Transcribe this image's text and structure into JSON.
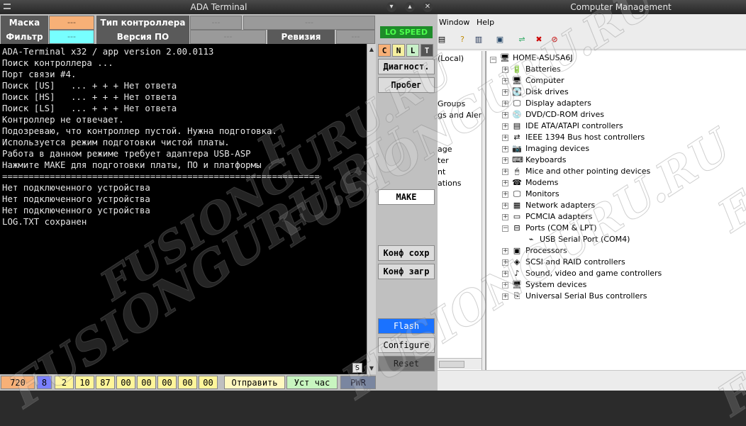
{
  "ada": {
    "title": "ADA Terminal",
    "labels": {
      "mask": "Маска",
      "filter": "Фильтр",
      "controller_type": "Тип контроллера",
      "version": "Версия ПО",
      "revision": "Ревизия"
    },
    "values": {
      "mask": "---",
      "filter": "---",
      "controller_type_1": "---",
      "controller_type_2": "---",
      "version": "---",
      "revision": "---"
    },
    "speed_badge": "LO SPEED",
    "cnlt": [
      "C",
      "N",
      "L",
      "T"
    ],
    "buttons": {
      "diag": "Диагност.",
      "probeg": "Пробег",
      "make": "MAKE",
      "conf_save": "Конф сохр",
      "conf_load": "Конф загр",
      "flash": "Flash",
      "configure": "Configure",
      "reset": "Reset"
    },
    "terminal_lines": [
      "ADA-Terminal x32 / app version 2.00.0113",
      "Поиск контроллера ...",
      "Порт связи #4.",
      "Поиск [US]   ... + + + Нет ответа",
      "Поиск [HS]   ... + + + Нет ответа",
      "Поиск [LS]   ... + + + Нет ответа",
      "Контроллер не отвечает.",
      "Подозреваю, что контроллер пустой. Нужна подготовка.",
      "Используется режим подготовки чистой платы.",
      "Работа в данном режиме требует адаптера USB-ASP",
      "Нажмите MAKE для подготовки платы, ПО и платформы",
      "============================================================",
      "Нет подключенного устройства",
      "Нет подключенного устройства",
      "Нет подключенного устройства",
      "LOG.TXT сохранен"
    ],
    "scroll_badge": "S",
    "status": {
      "num1": "720",
      "num2": "8",
      "bytes": [
        "2",
        "10",
        "87",
        "00",
        "00",
        "00",
        "00",
        "00"
      ],
      "send": "Отправить",
      "set_clock": "Уст час",
      "pwr": "PWR"
    }
  },
  "cm": {
    "title": "Computer Management",
    "menu": [
      "Window",
      "Help"
    ],
    "left_items": [
      "(Local)",
      "Groups",
      "gs and Alerts",
      "age",
      "ter",
      "nt",
      "ations"
    ],
    "root": "HOME-ASUSA6J",
    "devices": [
      {
        "label": "Batteries",
        "icon": "battery-icon",
        "glyph": "🔋"
      },
      {
        "label": "Computer",
        "icon": "computer-icon",
        "glyph": "🖥"
      },
      {
        "label": "Disk drives",
        "icon": "disk-drive-icon",
        "glyph": "💽"
      },
      {
        "label": "Display adapters",
        "icon": "display-adapter-icon",
        "glyph": "🖵"
      },
      {
        "label": "DVD/CD-ROM drives",
        "icon": "dvd-drive-icon",
        "glyph": "💿"
      },
      {
        "label": "IDE ATA/ATAPI controllers",
        "icon": "ide-controller-icon",
        "glyph": "▤"
      },
      {
        "label": "IEEE 1394 Bus host controllers",
        "icon": "ieee1394-icon",
        "glyph": "⇄"
      },
      {
        "label": "Imaging devices",
        "icon": "imaging-device-icon",
        "glyph": "📷"
      },
      {
        "label": "Keyboards",
        "icon": "keyboard-icon",
        "glyph": "⌨"
      },
      {
        "label": "Mice and other pointing devices",
        "icon": "mouse-icon",
        "glyph": "🖱"
      },
      {
        "label": "Modems",
        "icon": "modem-icon",
        "glyph": "☎"
      },
      {
        "label": "Monitors",
        "icon": "monitor-icon",
        "glyph": "🖵"
      },
      {
        "label": "Network adapters",
        "icon": "network-adapter-icon",
        "glyph": "▦"
      },
      {
        "label": "PCMCIA adapters",
        "icon": "pcmcia-icon",
        "glyph": "▭"
      },
      {
        "label": "Ports (COM & LPT)",
        "icon": "port-icon",
        "glyph": "⊟"
      },
      {
        "label": "USB Serial Port (COM4)",
        "icon": "serial-port-icon",
        "glyph": "⌁",
        "child": true
      },
      {
        "label": "Processors",
        "icon": "processor-icon",
        "glyph": "▣"
      },
      {
        "label": "SCSI and RAID controllers",
        "icon": "scsi-controller-icon",
        "glyph": "◈"
      },
      {
        "label": "Sound, video and game controllers",
        "icon": "sound-controller-icon",
        "glyph": "♪"
      },
      {
        "label": "System devices",
        "icon": "system-device-icon",
        "glyph": "🖥"
      },
      {
        "label": "Universal Serial Bus controllers",
        "icon": "usb-controller-icon",
        "glyph": "⎘"
      }
    ]
  },
  "watermarks": [
    "FUSIONGURU.RU",
    "FUSIONGURU.RU",
    "FUSIONGURU.RU",
    "FUSIONGURU.RU",
    "F",
    "F",
    "F"
  ]
}
